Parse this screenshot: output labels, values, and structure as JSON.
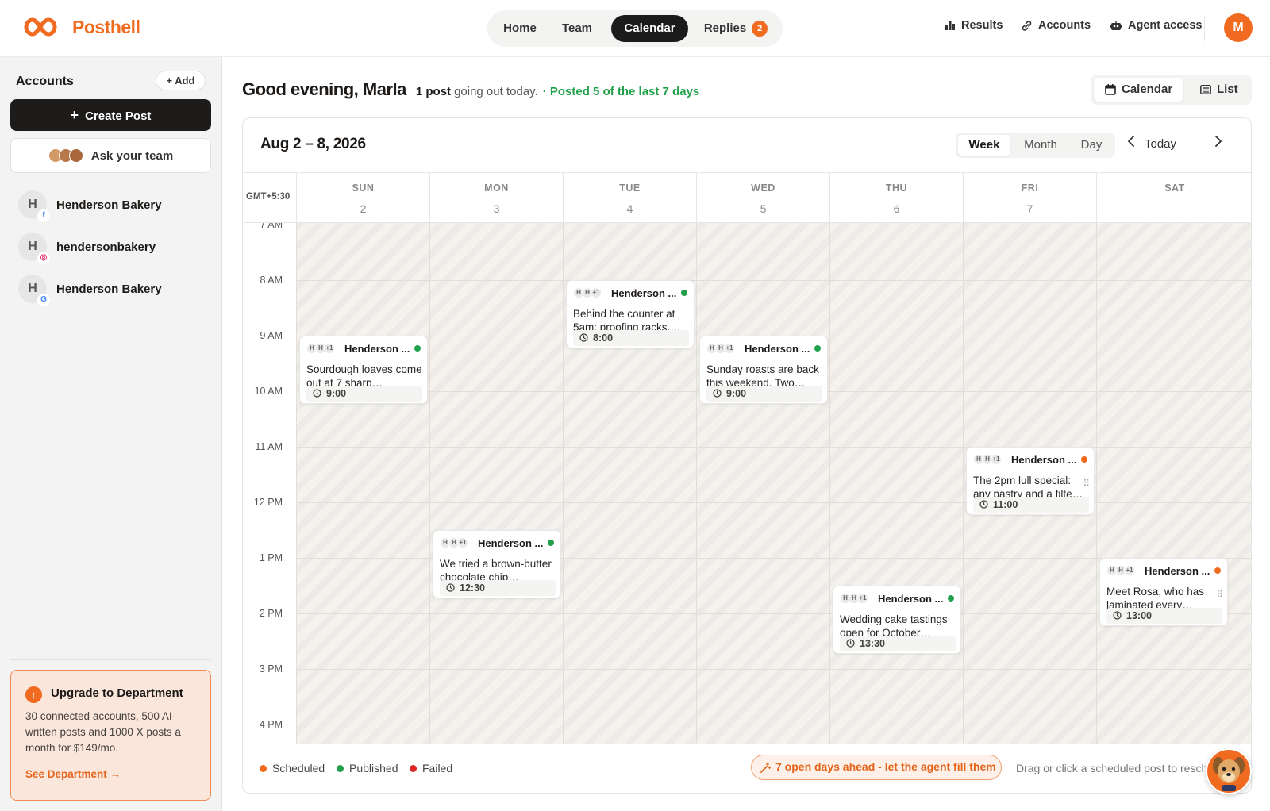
{
  "brand": {
    "name": "Posthell",
    "accent": "#f06a1f"
  },
  "nav": {
    "items": [
      {
        "label": "Home"
      },
      {
        "label": "Team"
      },
      {
        "label": "Calendar",
        "active": true
      },
      {
        "label": "Replies",
        "badge": "2"
      }
    ],
    "right": [
      {
        "label": "Results",
        "icon": "bar-chart-icon"
      },
      {
        "label": "Accounts",
        "icon": "link-icon"
      },
      {
        "label": "Agent access",
        "icon": "robot-icon"
      }
    ],
    "user_initial": "M"
  },
  "sidebar": {
    "title": "Accounts",
    "add_label": "Add",
    "create_label": "Create Post",
    "ask_label": "Ask your team",
    "accounts": [
      {
        "name": "Henderson Bakery",
        "initial": "H",
        "platform": "facebook",
        "platform_glyph": "f"
      },
      {
        "name": "hendersonbakery",
        "initial": "H",
        "platform": "instagram",
        "platform_glyph": "◎"
      },
      {
        "name": "Henderson Bakery",
        "initial": "H",
        "platform": "google",
        "platform_glyph": "G"
      }
    ],
    "upgrade": {
      "title": "Upgrade to Department",
      "body": "30 connected accounts, 500 AI-written posts and 1000 X posts a month for $149/mo.",
      "link": "See Department →"
    }
  },
  "header": {
    "greeting": "Good evening, Marla",
    "post_count": "1 post",
    "post_rest": "going out today.",
    "posted_status": "· Posted 5 of the last 7 days",
    "view_calendar": "Calendar",
    "view_list": "List"
  },
  "calendar": {
    "range": "Aug 2 – 8, 2026",
    "views": [
      "Week",
      "Month",
      "Day"
    ],
    "active_view": "Week",
    "today_label": "Today",
    "timezone": "GMT+5:30",
    "days": [
      {
        "name": "SUN",
        "num": "2"
      },
      {
        "name": "MON",
        "num": "3"
      },
      {
        "name": "TUE",
        "num": "4"
      },
      {
        "name": "WED",
        "num": "5"
      },
      {
        "name": "THU",
        "num": "6"
      },
      {
        "name": "FRI",
        "num": "7"
      },
      {
        "name": "SAT",
        "num": "8",
        "today": true
      }
    ],
    "hours": [
      "7 AM",
      "8 AM",
      "9 AM",
      "10 AM",
      "11 AM",
      "12 PM",
      "1 PM",
      "2 PM",
      "3 PM",
      "4 PM"
    ],
    "posts": [
      {
        "day": 0,
        "time": "9:00",
        "title": "Henderson ...",
        "text": "Sourdough loaves come out at 7 sharp…",
        "status": "published"
      },
      {
        "day": 1,
        "time": "12:30",
        "title": "Henderson ...",
        "text": "We tried a brown-butter chocolate chip…",
        "status": "published"
      },
      {
        "day": 2,
        "time": "8:00",
        "title": "Henderson ...",
        "text": "Behind the counter at 5am: proofing racks,…",
        "status": "published"
      },
      {
        "day": 3,
        "time": "9:00",
        "title": "Henderson ...",
        "text": "Sunday roasts are back this weekend. Two…",
        "status": "published"
      },
      {
        "day": 4,
        "time": "13:30",
        "title": "Henderson ...",
        "text": "Wedding cake tastings open for October…",
        "status": "published"
      },
      {
        "day": 5,
        "time": "11:00",
        "title": "Henderson ...",
        "text": "The 2pm lull special: any pastry and a filte…",
        "status": "scheduled"
      },
      {
        "day": 6,
        "time": "13:00",
        "title": "Henderson ...",
        "text": "Meet Rosa, who has laminated every…",
        "status": "scheduled"
      }
    ],
    "status_colors": {
      "scheduled": "#f06a1f",
      "published": "#22a04b",
      "failed": "#dc2626"
    }
  },
  "footer": {
    "legend": [
      {
        "label": "Scheduled",
        "color": "#f06a1f"
      },
      {
        "label": "Published",
        "color": "#22a04b"
      },
      {
        "label": "Failed",
        "color": "#dc2626"
      }
    ],
    "agent_cta": "7 open days ahead - let the agent fill them",
    "hint": "Drag or click a scheduled post to resch"
  }
}
